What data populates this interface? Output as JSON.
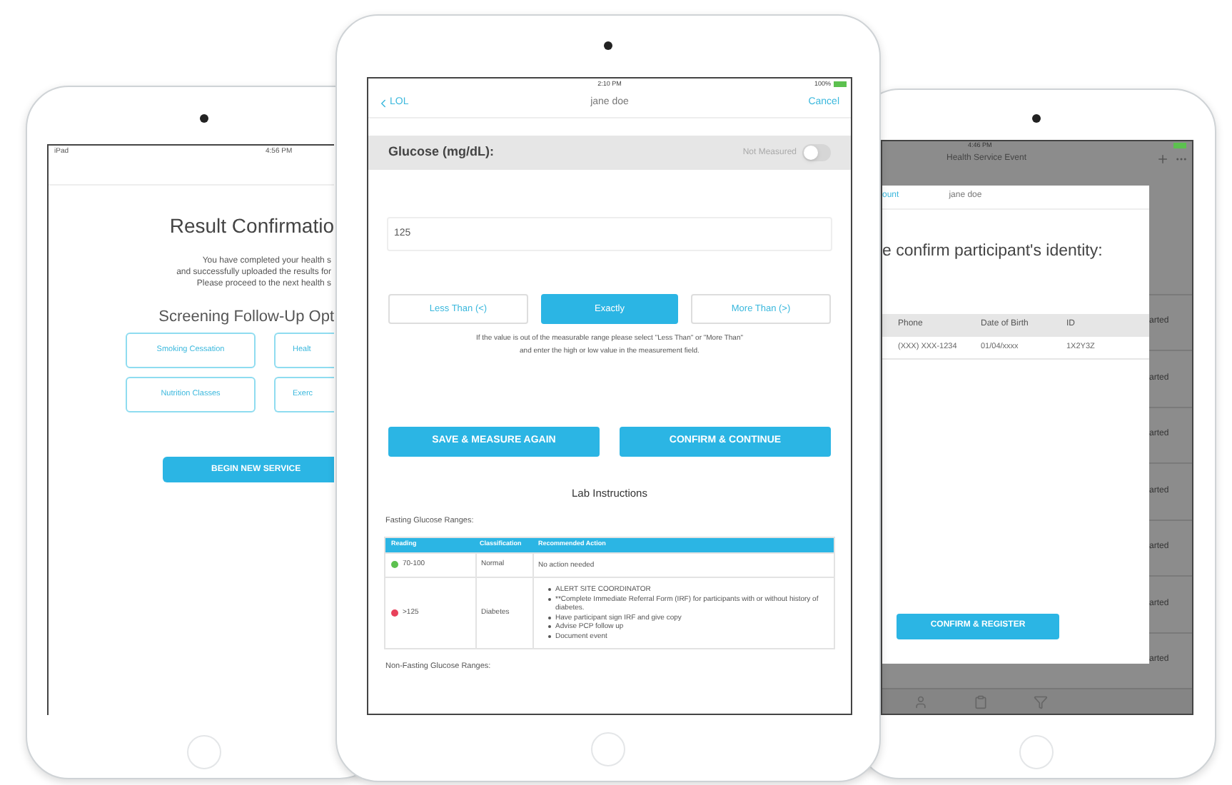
{
  "left_tablet": {
    "status_bar": {
      "carrier": "iPad",
      "time": "4:56 PM"
    },
    "title": "Result Confirmatio",
    "message_lines": [
      "You have completed your health s",
      "and successfully uploaded the results for",
      "Please proceed to the next health s"
    ],
    "options_heading": "Screening Follow-Up Opt",
    "options": [
      [
        "Smoking Cessation",
        "Healt"
      ],
      [
        "Nutrition Classes",
        "Exerc"
      ]
    ],
    "primary_button": "BEGIN NEW SERVICE"
  },
  "center_tablet": {
    "status_bar": {
      "time": "2:10 PM",
      "battery": "100%"
    },
    "nav": {
      "back": "LOL",
      "title": "jane doe",
      "action": "Cancel"
    },
    "measure": {
      "label": "Glucose (mg/dL):",
      "toggle_label": "Not Measured",
      "on": false
    },
    "value": "125",
    "modes": [
      {
        "label": "Less Than (<)",
        "selected": false
      },
      {
        "label": "Exactly",
        "selected": true
      },
      {
        "label": "More Than (>)",
        "selected": false
      }
    ],
    "hint_lines": [
      "If the value is out of the measurable range please select \"Less Than\" or \"More Than\"",
      "and enter the high or low value in the measurement field."
    ],
    "actions": [
      "SAVE & MEASURE AGAIN",
      "CONFIRM & CONTINUE"
    ],
    "lab_title": "Lab Instructions",
    "fasting_title": "Fasting Glucose Ranges:",
    "table": {
      "columns": [
        "Reading",
        "Classification",
        "Recommended Action"
      ],
      "rows": [
        {
          "color": "#5cc14f",
          "reading": "70-100",
          "classification": "Normal",
          "actions": [
            "No action needed"
          ]
        },
        {
          "color": "#e8415b",
          "reading": ">125",
          "classification": "Diabetes",
          "actions": [
            "ALERT SITE COORDINATOR",
            "**Complete Immediate Referral Form (IRF) for participants with or without history of diabetes.",
            "Have participant sign IRF and give copy",
            "Advise PCP follow up",
            "Document event"
          ]
        }
      ]
    },
    "non_fasting_title": "Non-Fasting Glucose Ranges:"
  },
  "right_tablet": {
    "status_bar": {
      "time": "4:46 PM"
    },
    "nav": {
      "title": "Health Service Event"
    },
    "list_rows": [
      "arted",
      "arted",
      "arted",
      "arted",
      "arted",
      "arted",
      "arted"
    ],
    "modal": {
      "tab": "ount",
      "name": "jane doe",
      "title": "e confirm participant's identity:",
      "columns": [
        "Phone",
        "Date of Birth",
        "ID"
      ],
      "row": [
        "(XXX) XXX-1234",
        "01/04/xxxx",
        "1X2Y3Z"
      ],
      "button": "CONFIRM & REGISTER"
    }
  }
}
